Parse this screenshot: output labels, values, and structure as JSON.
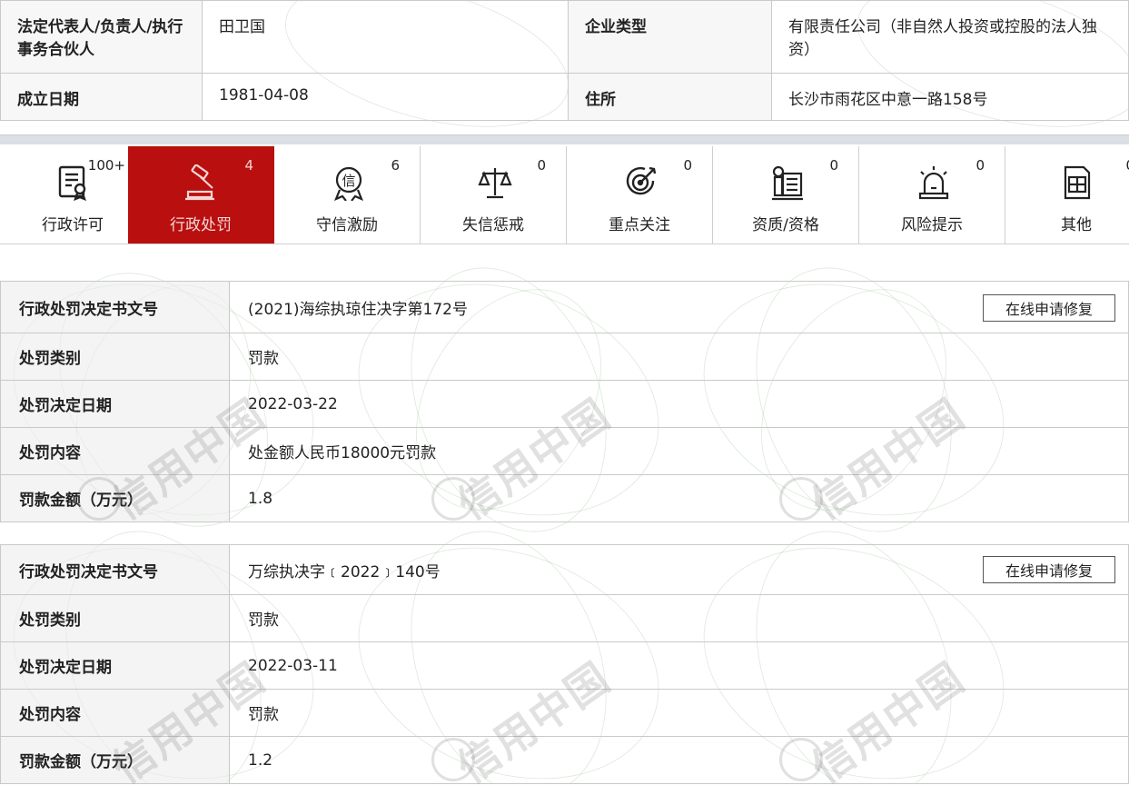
{
  "company_info": {
    "legal_rep_label": "法定代表人/负责人/执行事务合伙人",
    "legal_rep_value": "田卫国",
    "company_type_label": "企业类型",
    "company_type_value": "有限责任公司（非自然人投资或控股的法人独资）",
    "founded_label": "成立日期",
    "founded_value": "1981-04-08",
    "address_label": "住所",
    "address_value": "长沙市雨花区中意一路158号"
  },
  "tabs": [
    {
      "label": "行政许可",
      "count": "100+",
      "icon": "license-document-icon",
      "active": false
    },
    {
      "label": "行政处罚",
      "count": "4",
      "icon": "gavel-icon",
      "active": true
    },
    {
      "label": "守信激励",
      "count": "6",
      "icon": "trust-badge-icon",
      "active": false
    },
    {
      "label": "失信惩戒",
      "count": "0",
      "icon": "scales-icon",
      "active": false
    },
    {
      "label": "重点关注",
      "count": "0",
      "icon": "target-icon",
      "active": false
    },
    {
      "label": "资质/资格",
      "count": "0",
      "icon": "certificate-icon",
      "active": false
    },
    {
      "label": "风险提示",
      "count": "0",
      "icon": "alarm-light-icon",
      "active": false
    },
    {
      "label": "其他",
      "count": "0",
      "icon": "other-document-icon",
      "active": false
    }
  ],
  "repair_button_label": "在线申请修复",
  "watermark_text": "信用中国",
  "records": [
    {
      "doc_no_label": "行政处罚决定书文号",
      "doc_no_value": "(2021)海综执琼住决字第172号",
      "category_label": "处罚类别",
      "category_value": "罚款",
      "date_label": "处罚决定日期",
      "date_value": "2022-03-22",
      "content_label": "处罚内容",
      "content_value": "处金额人民币18000元罚款",
      "amount_label": "罚款金额（万元）",
      "amount_value": "1.8"
    },
    {
      "doc_no_label": "行政处罚决定书文号",
      "doc_no_value": "万综执决字﹝2022﹞140号",
      "category_label": "处罚类别",
      "category_value": "罚款",
      "date_label": "处罚决定日期",
      "date_value": "2022-03-11",
      "content_label": "处罚内容",
      "content_value": "罚款",
      "amount_label": "罚款金额（万元）",
      "amount_value": "1.2"
    }
  ]
}
